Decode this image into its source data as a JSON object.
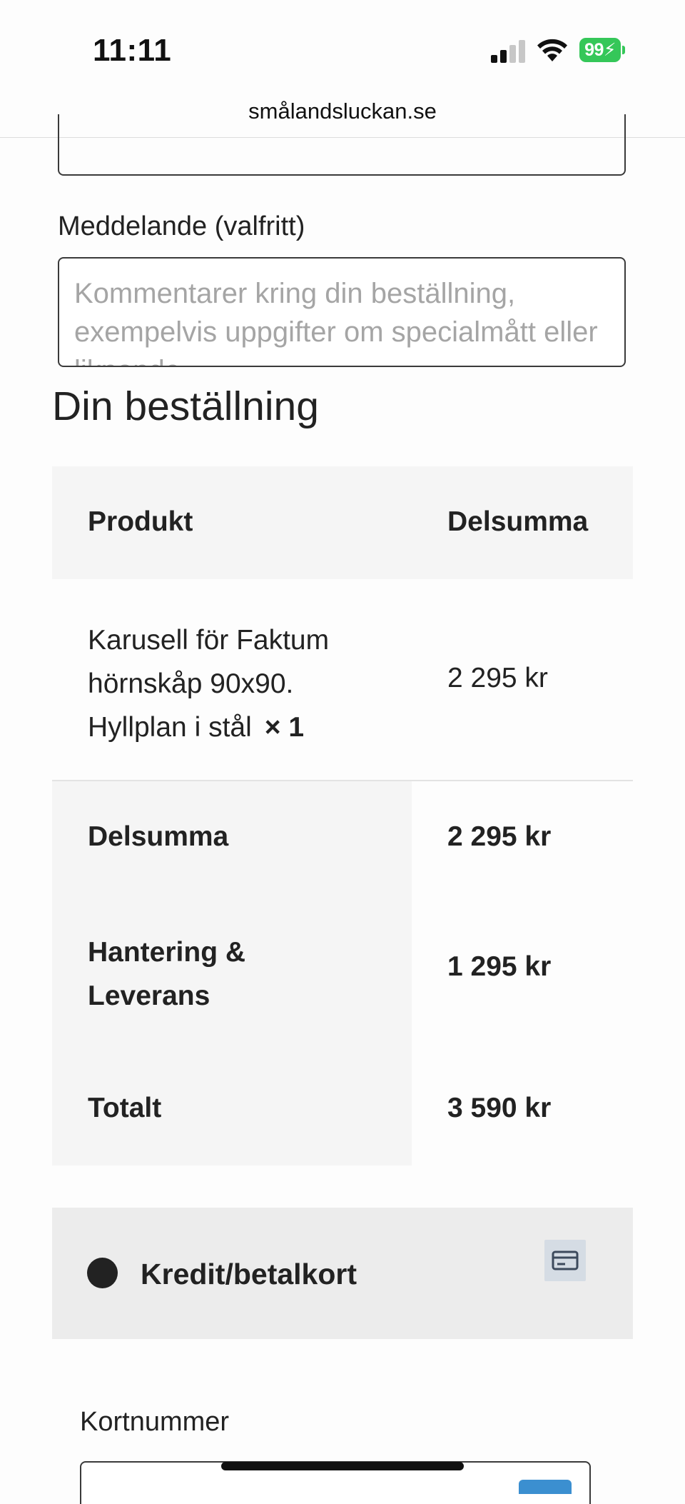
{
  "status_bar": {
    "time": "11:11",
    "battery_level": "99",
    "battery_color": "#35c759",
    "icons": [
      "signal-icon",
      "wifi-icon",
      "battery-charging-icon"
    ]
  },
  "browser": {
    "url": "smålandsluckan.se"
  },
  "form": {
    "message_label": "Meddelande (valfritt)",
    "message_placeholder": "Kommentarer kring din beställning, exempelvis uppgifter om specialmått eller liknande."
  },
  "order": {
    "title": "Din beställning",
    "header": {
      "product": "Produkt",
      "subtotal": "Delsumma"
    },
    "item": {
      "name": "Karusell för Faktum hörnskåp 90x90. Hyllplan i stål",
      "quantity": "× 1",
      "price": "2 295 kr"
    },
    "totals": {
      "subtotal_label": "Delsumma",
      "subtotal_value": "2 295 kr",
      "shipping_label": "Hantering & Leverans",
      "shipping_value": "1 295 kr",
      "total_label": "Totalt",
      "total_value": "3 590 kr"
    }
  },
  "payment": {
    "method_label": "Kredit/betalkort",
    "method_icon": "credit-card-icon",
    "card_number_label": "Kortnummer"
  }
}
